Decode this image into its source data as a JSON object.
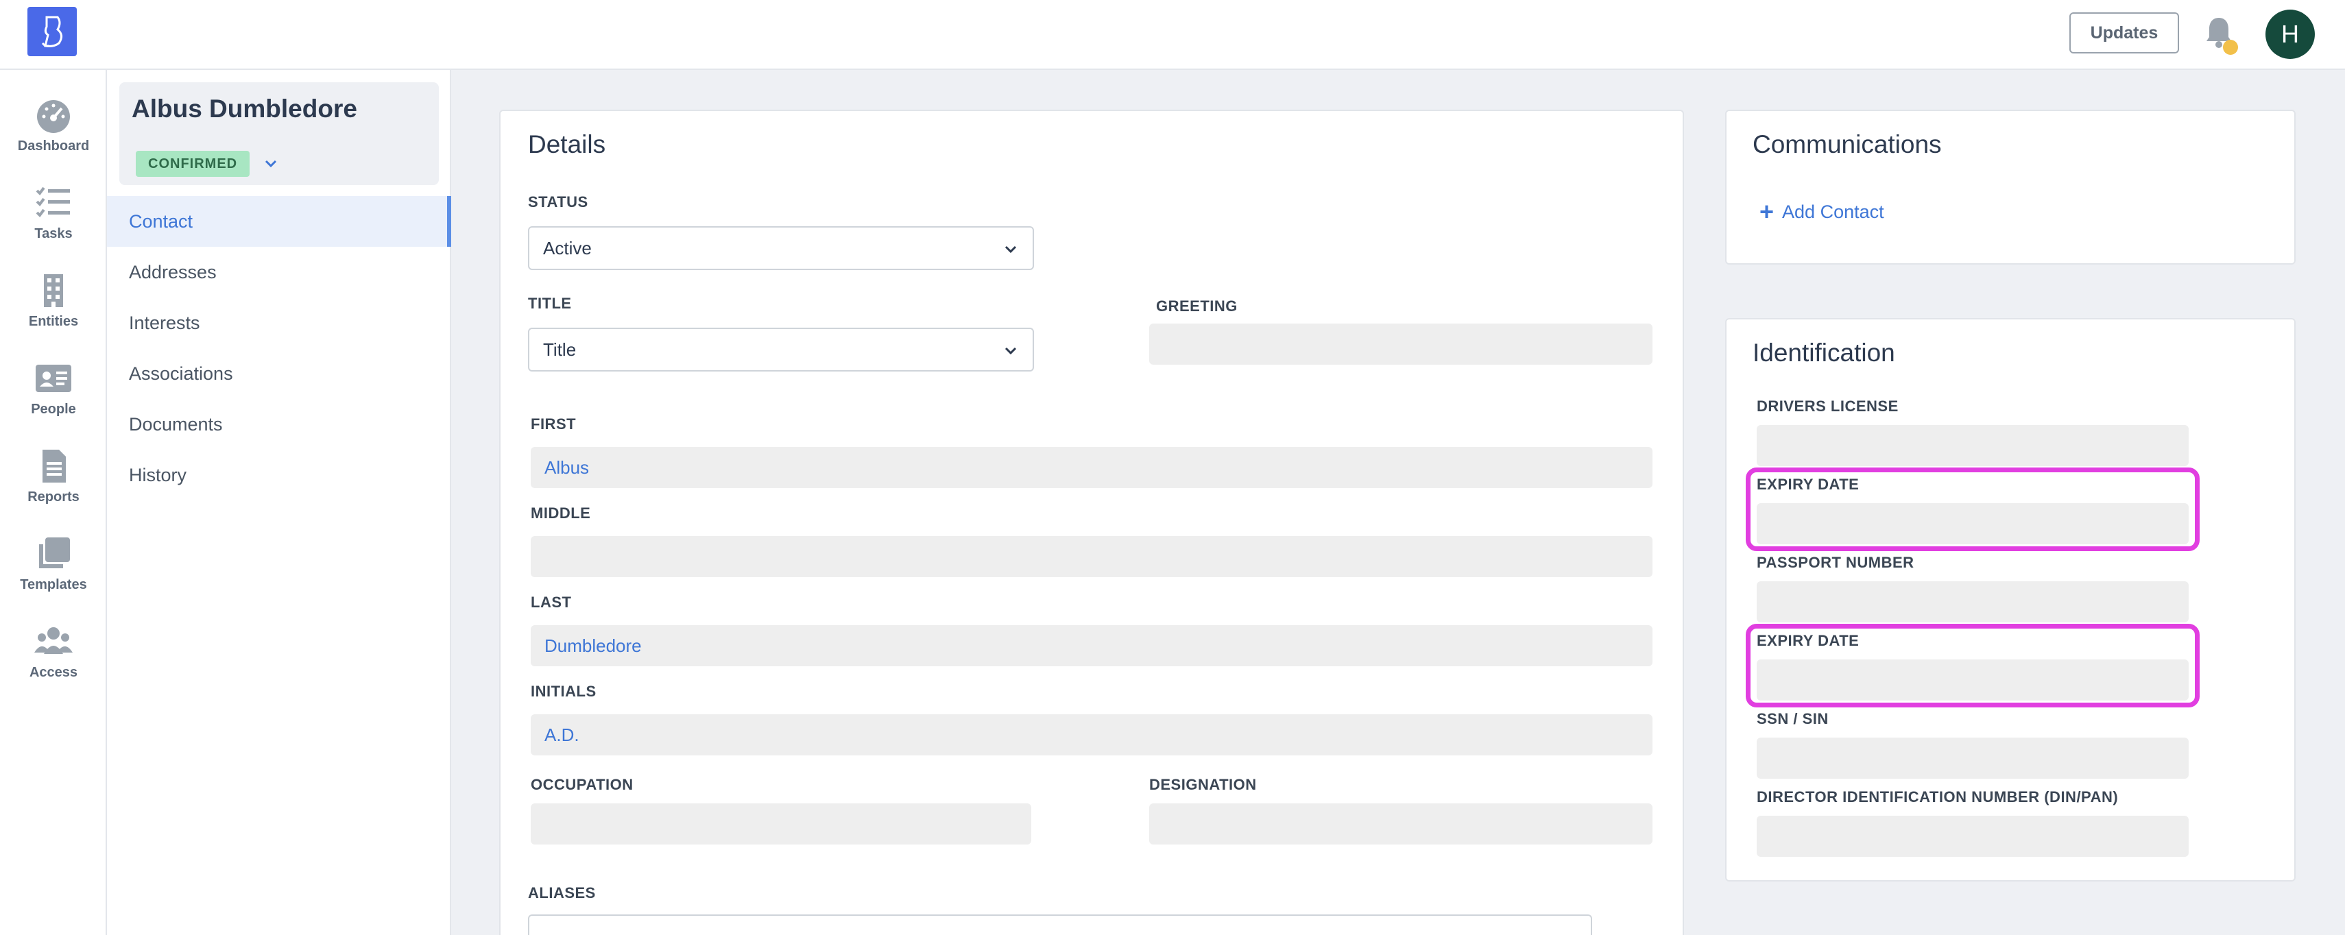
{
  "header": {
    "updates_label": "Updates",
    "avatar_initial": "H",
    "notification_dot_color": "#f2c04a"
  },
  "rail": {
    "items": [
      {
        "label": "Dashboard",
        "icon": "dashboard-gauge-icon"
      },
      {
        "label": "Tasks",
        "icon": "tasks-checklist-icon"
      },
      {
        "label": "Entities",
        "icon": "building-icon"
      },
      {
        "label": "People",
        "icon": "id-card-icon"
      },
      {
        "label": "Reports",
        "icon": "document-icon"
      },
      {
        "label": "Templates",
        "icon": "copy-icon"
      },
      {
        "label": "Access",
        "icon": "users-icon"
      }
    ]
  },
  "profile": {
    "name": "Albus Dumbledore",
    "status_badge": "CONFIRMED"
  },
  "subnav": {
    "items": [
      "Contact",
      "Addresses",
      "Interests",
      "Associations",
      "Documents",
      "History"
    ],
    "active": "Contact"
  },
  "details": {
    "title": "Details",
    "status_label": "STATUS",
    "status_value": "Active",
    "title_label": "TITLE",
    "title_value": "Title",
    "greeting_label": "GREETING",
    "greeting_value": "",
    "first_label": "FIRST",
    "first_value": "Albus",
    "middle_label": "MIDDLE",
    "middle_value": "",
    "last_label": "LAST",
    "last_value": "Dumbledore",
    "initials_label": "INITIALS",
    "initials_value": "A.D.",
    "occupation_label": "OCCUPATION",
    "occupation_value": "",
    "designation_label": "DESIGNATION",
    "designation_value": "",
    "aliases_label": "ALIASES"
  },
  "communications": {
    "title": "Communications",
    "add_contact_label": "Add Contact"
  },
  "identification": {
    "title": "Identification",
    "drivers_license_label": "DRIVERS LICENSE",
    "drivers_expiry_label": "EXPIRY DATE",
    "passport_label": "PASSPORT NUMBER",
    "passport_expiry_label": "EXPIRY DATE",
    "ssn_label": "SSN / SIN",
    "din_label": "DIRECTOR IDENTIFICATION NUMBER (DIN/PAN)"
  },
  "colors": {
    "accent": "#3e76d6",
    "highlight": "#e13ee0",
    "badge_bg": "#a8e6c2",
    "logo_bg": "#4a69e8",
    "avatar_bg": "#154a3c"
  }
}
